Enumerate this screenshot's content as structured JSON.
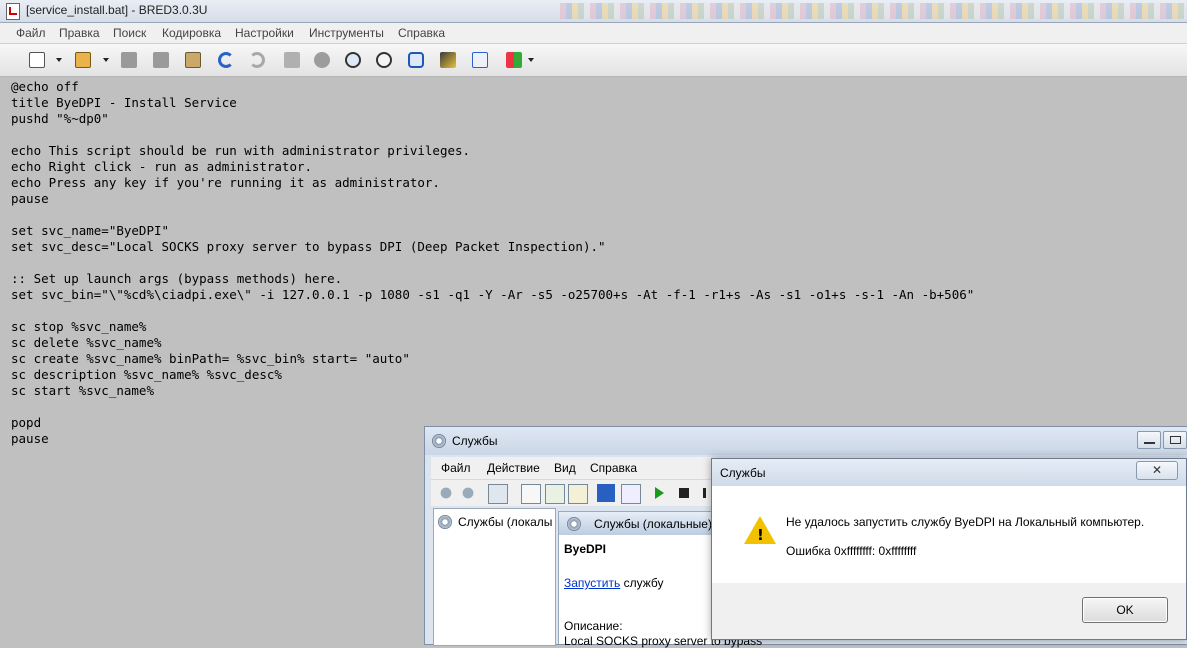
{
  "editor": {
    "window_title": "[service_install.bat] - BRED3.0.3U",
    "menu": [
      "Файл",
      "Правка",
      "Поиск",
      "Кодировка",
      "Настройки",
      "Инструменты",
      "Справка"
    ],
    "code_lines": [
      "@echo off",
      "title ByeDPI - Install Service",
      "pushd \"%~dp0\"",
      "",
      "echo This script should be run with administrator privileges.",
      "echo Right click - run as administrator.",
      "echo Press any key if you're running it as administrator.",
      "pause",
      "",
      "set svc_name=\"ByeDPI\"",
      "set svc_desc=\"Local SOCKS proxy server to bypass DPI (Deep Packet Inspection).\"",
      "",
      ":: Set up launch args (bypass methods) here.",
      "set svc_bin=\"\\\"%cd%\\ciadpi.exe\\\" -i 127.0.0.1 -p 1080 -s1 -q1 -Y -Ar -s5 -o25700+s -At -f-1 -r1+s -As -s1 -o1+s -s-1 -An -b+506\"",
      "",
      "sc stop %svc_name%",
      "sc delete %svc_name%",
      "sc create %svc_name% binPath= %svc_bin% start= \"auto\"",
      "sc description %svc_name% %svc_desc%",
      "sc start %svc_name%",
      "",
      "popd",
      "pause"
    ]
  },
  "services": {
    "window_title": "Службы",
    "menu": [
      "Файл",
      "Действие",
      "Вид",
      "Справка"
    ],
    "tree_item": "Службы (локалы",
    "pane_header": "Службы (локальные)",
    "service_name": "ByeDPI",
    "start_link": "Запустить",
    "start_suffix": " службу",
    "description_label": "Описание:",
    "description_text": "Local SOCKS proxy server to bypass"
  },
  "dialog": {
    "title": "Службы",
    "close_label": "✕",
    "message": "Не удалось запустить службу ByeDPI на Локальный компьютер.",
    "error": "Ошибка 0xffffffff: 0xffffffff",
    "ok_label": "OK"
  },
  "colors": {
    "editor_bg": "#c0c0c0",
    "link": "#0033cc",
    "warning": "#f2c100"
  }
}
